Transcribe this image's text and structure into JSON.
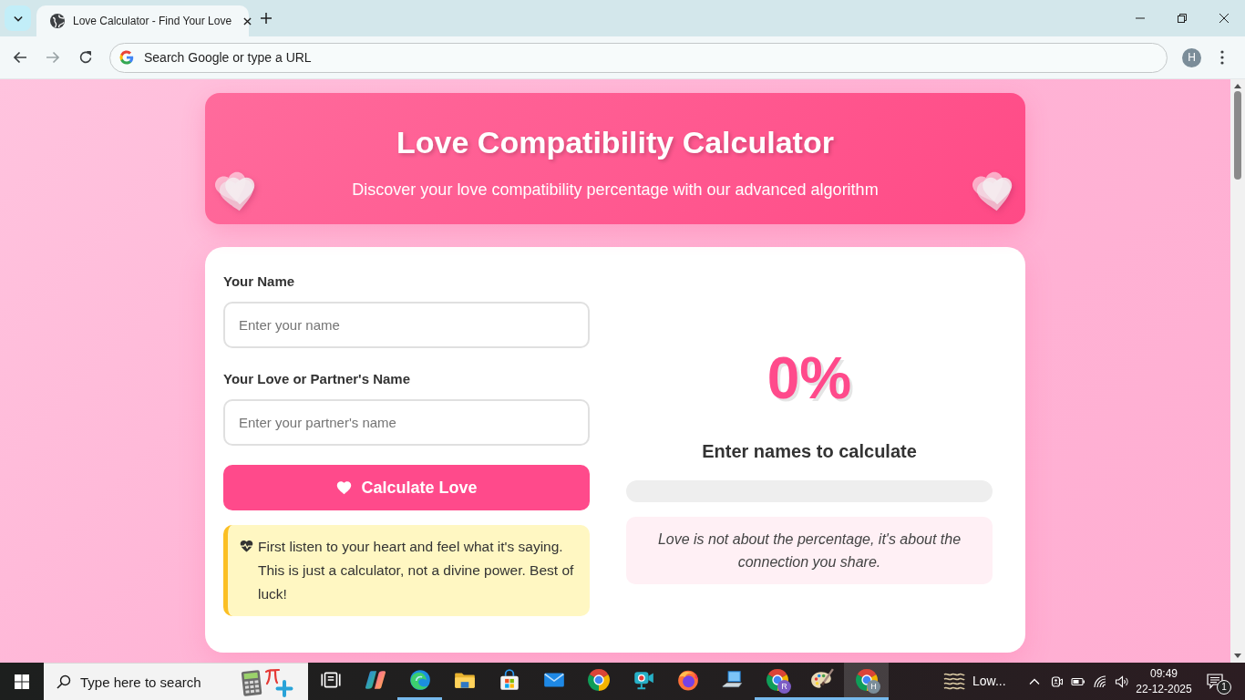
{
  "browser": {
    "tabs": [
      {
        "title": "Love Calculator - Find Your Love",
        "selected": true
      }
    ],
    "navigation": [
      {
        "kind": "back",
        "disabled": false
      },
      {
        "kind": "forward",
        "disabled": true
      },
      {
        "kind": "reload",
        "disabled": false
      }
    ],
    "address_bar": {
      "placeholder": "Search Google or type a URL"
    },
    "profile_initial": "H"
  },
  "page": {
    "header": {
      "title": "Love Compatibility Calculator",
      "subtitle": "Discover your love compatibility percentage with our advanced algorithm"
    },
    "form": {
      "fields": [
        {
          "label": "Your Name",
          "placeholder": "Enter your name"
        },
        {
          "label": "Your Love or Partner's Name",
          "placeholder": "Enter your partner's name"
        }
      ],
      "button": "Calculate Love",
      "note": "First listen to your heart and feel what it's saying. This is just a calculator, not a divine power. Best of luck!"
    },
    "result": {
      "percentage": "0%",
      "status": "Enter names to calculate",
      "level": 0,
      "quote": "Love is not about the percentage, it's about the connection you share."
    }
  },
  "taskbar": {
    "search_placeholder": "Type here to search",
    "apps": [
      {
        "kind": "taskview",
        "running": false,
        "selected": false
      },
      {
        "kind": "copilot",
        "running": false,
        "selected": false
      },
      {
        "kind": "edge",
        "running": true,
        "selected": false
      },
      {
        "kind": "folder",
        "running": false,
        "selected": false
      },
      {
        "kind": "store",
        "running": false,
        "selected": false
      },
      {
        "kind": "mail",
        "running": false,
        "selected": false
      },
      {
        "kind": "chrome",
        "running": false,
        "selected": false
      },
      {
        "kind": "camera",
        "running": false,
        "selected": false
      },
      {
        "kind": "firefox",
        "running": false,
        "selected": false
      },
      {
        "kind": "laptop",
        "running": false,
        "selected": false
      },
      {
        "kind": "chrome",
        "running": true,
        "selected": false,
        "badge": "R",
        "color": "#7c5cc4"
      },
      {
        "kind": "paint",
        "running": true,
        "selected": false
      },
      {
        "kind": "chrome",
        "running": true,
        "selected": true,
        "badge": "H",
        "color": "#7b8d99"
      }
    ],
    "weather": "Low...",
    "time": "09:49",
    "date": "22-12-2025",
    "notification_count": "1"
  }
}
